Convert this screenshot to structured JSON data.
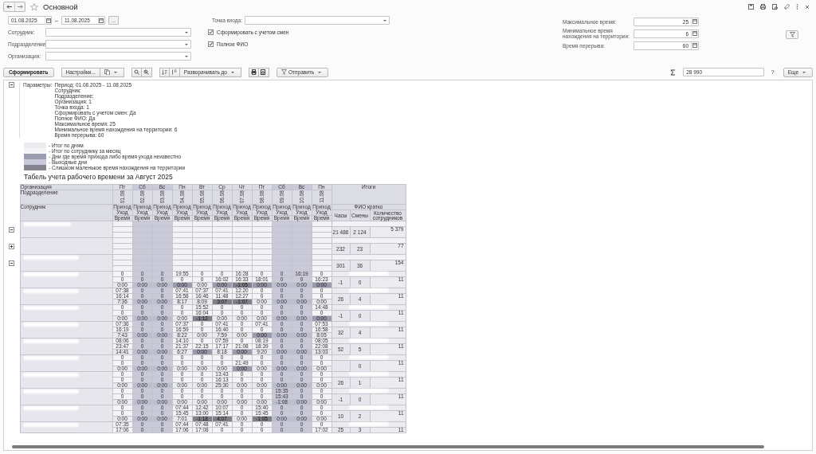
{
  "window": {
    "title": "Основной"
  },
  "filters": {
    "date_from": "01.08.2025",
    "dash": "–",
    "date_to": "11.08.2025",
    "more": "...",
    "fields": [
      {
        "label": "Сотрудник:"
      },
      {
        "label": "Подразделение:"
      },
      {
        "label": "Организация:"
      }
    ],
    "entry_point": {
      "label": "Точка входа:"
    },
    "checkboxes": [
      {
        "label": "Сформировать с учетом смен",
        "checked": true
      },
      {
        "label": "Полное ФИО",
        "checked": true
      }
    ],
    "numbers": [
      {
        "label": "Максимальное время:",
        "value": "25"
      },
      {
        "label": "Минимальное время нахождения на территории:",
        "value": "6"
      },
      {
        "label": "Время перерыва:",
        "value": "60"
      }
    ]
  },
  "toolbar": {
    "generate": "Сформировать",
    "settings": "Настройки...",
    "expand": "Разворачивать до",
    "send": "Отправить",
    "sum": "28 990",
    "help": "?",
    "more": "Еще"
  },
  "report": {
    "parameters": {
      "expanded": true,
      "label": "Параметры:",
      "lines": [
        "Период: 01.08.2025 - 11.08.2025",
        "Сотрудник:",
        "Подразделение:",
        "Организация: 1",
        "Точка входа: 1",
        "Сформировать с учетом смен: Да",
        "Полное ФИО: Да",
        "Максимальное время: 25",
        "Минимальное время нахождения на территории: 6",
        "Время перерыва: 60"
      ]
    },
    "legend": [
      {
        "color": "#ececf0",
        "text": "- Итог по дням"
      },
      {
        "color": "#f4f4f6",
        "text": "- Итог по сотруднику за месяц"
      },
      {
        "color": "#9c9cb0",
        "text": "- Дни где время прихода либо время ухода неизвестно"
      },
      {
        "color": "#c8c8da",
        "text": "- Выходные дни"
      },
      {
        "color": "#85858f",
        "text": "- Слишком маленькое время нахождения на территории"
      }
    ],
    "title": "Табель учета рабочего времени за Август 2025",
    "table": {
      "header": {
        "organization": "Организация",
        "department": "Подразделение",
        "employee": "Сотрудник",
        "totals": "Итоги",
        "short_name": "ФИО кратко",
        "hours": "Часы",
        "shifts": "Смены",
        "count": "Количество сотрудников"
      },
      "days": [
        {
          "dow": "Пт",
          "date": "01.08",
          "weekend": false,
          "arrive": "Приход",
          "leave": "Уход",
          "time": "Время"
        },
        {
          "dow": "Сб",
          "date": "02.08",
          "weekend": true,
          "arrive": "Приход",
          "leave": "Уход",
          "time": "Время"
        },
        {
          "dow": "Вс",
          "date": "03.08",
          "weekend": true,
          "arrive": "Приход",
          "leave": "Уход",
          "time": "Время"
        },
        {
          "dow": "Пн",
          "date": "04.08",
          "weekend": false,
          "arrive": "Приход",
          "leave": "Уход",
          "time": "Время"
        },
        {
          "dow": "Вт",
          "date": "05.08",
          "weekend": false,
          "arrive": "Приход",
          "leave": "Уход",
          "time": "Время"
        },
        {
          "dow": "Ср",
          "date": "06.08",
          "weekend": false,
          "arrive": "Приход",
          "leave": "Уход",
          "time": "Время"
        },
        {
          "dow": "Чт",
          "date": "07.08",
          "weekend": false,
          "arrive": "Приход",
          "leave": "Уход",
          "time": "Время"
        },
        {
          "dow": "Пт",
          "date": "08.08",
          "weekend": false,
          "arrive": "Приход",
          "leave": "Уход",
          "time": "Время"
        },
        {
          "dow": "Сб",
          "date": "09.08",
          "weekend": true,
          "arrive": "Приход",
          "leave": "Уход",
          "time": "Время"
        },
        {
          "dow": "Вс",
          "date": "10.08",
          "weekend": true,
          "arrive": "Приход",
          "leave": "Уход",
          "time": "Время"
        },
        {
          "dow": "Пн",
          "date": "11.08",
          "weekend": false,
          "arrive": "Приход",
          "leave": "Уход",
          "time": "Время"
        }
      ],
      "groups": [
        {
          "expanded": true,
          "hours": "21 486",
          "shifts": "2 124",
          "count": "5 379"
        },
        {
          "expanded": false,
          "hours": "232",
          "shifts": "23",
          "count": "77"
        },
        {
          "expanded": true,
          "hours": "301",
          "shifts": "36",
          "count": "154"
        }
      ],
      "employees": [
        {
          "arrive": [
            "0",
            "0",
            "0",
            "19:55",
            "0",
            "0",
            "16:28",
            "0",
            "0",
            "16:19",
            "0"
          ],
          "leave": [
            "0",
            "0",
            "0",
            "0",
            "0",
            "16:02",
            "16:33",
            "18:01",
            "0",
            "0",
            "16:23"
          ],
          "time": [
            {
              "v": "0:00",
              "unknown": false,
              "short": false
            },
            {
              "v": "0:00",
              "unknown": false,
              "short": false
            },
            {
              "v": "0:00",
              "unknown": false,
              "short": false
            },
            {
              "v": "0:00",
              "unknown": true,
              "short": false
            },
            {
              "v": "0:00",
              "unknown": false,
              "short": false
            },
            {
              "v": "0:00",
              "unknown": true,
              "short": false
            },
            {
              "v": "-1:05",
              "unknown": false,
              "short": true
            },
            {
              "v": "0:00",
              "unknown": true,
              "short": false
            },
            {
              "v": "0:00",
              "unknown": false,
              "short": false
            },
            {
              "v": "0:00",
              "unknown": false,
              "short": false
            },
            {
              "v": "0:00",
              "unknown": true,
              "short": false
            }
          ],
          "hours": "-1",
          "shifts": "0",
          "count": "11"
        },
        {
          "arrive": [
            "07:38",
            "0",
            "0",
            "07:41",
            "07:37",
            "07:41",
            "12:20",
            "0",
            "0",
            "0",
            "0"
          ],
          "leave": [
            "16:14",
            "0",
            "0",
            "16:58",
            "16:46",
            "11:48",
            "12:27",
            "0",
            "0",
            "0",
            "0"
          ],
          "time": [
            {
              "v": "7:36",
              "unknown": false,
              "short": false
            },
            {
              "v": "0:00",
              "unknown": false,
              "short": false
            },
            {
              "v": "0:00",
              "unknown": false,
              "short": false
            },
            {
              "v": "8:17",
              "unknown": false,
              "short": false
            },
            {
              "v": "8:09",
              "unknown": false,
              "short": false
            },
            {
              "v": "3:07",
              "unknown": false,
              "short": true
            },
            {
              "v": "-1:07",
              "unknown": false,
              "short": true
            },
            {
              "v": "0:00",
              "unknown": false,
              "short": false
            },
            {
              "v": "0:00",
              "unknown": false,
              "short": false
            },
            {
              "v": "0:00",
              "unknown": false,
              "short": false
            },
            {
              "v": "0:00",
              "unknown": false,
              "short": false
            }
          ],
          "hours": "26",
          "shifts": "4",
          "count": "11"
        },
        {
          "arrive": [
            "0",
            "0",
            "0",
            "0",
            "15:52",
            "0",
            "0",
            "0",
            "0",
            "0",
            "14:48"
          ],
          "leave": [
            "0",
            "0",
            "0",
            "0",
            "16:04",
            "0",
            "0",
            "0",
            "0",
            "0",
            "0"
          ],
          "time": [
            {
              "v": "0:00",
              "unknown": false,
              "short": false
            },
            {
              "v": "0:00",
              "unknown": false,
              "short": false
            },
            {
              "v": "0:00",
              "unknown": false,
              "short": false
            },
            {
              "v": "0:00",
              "unknown": false,
              "short": false
            },
            {
              "v": "-1:12",
              "unknown": false,
              "short": true
            },
            {
              "v": "0:00",
              "unknown": false,
              "short": false
            },
            {
              "v": "0:00",
              "unknown": false,
              "short": false
            },
            {
              "v": "0:00",
              "unknown": false,
              "short": false
            },
            {
              "v": "0:00",
              "unknown": false,
              "short": false
            },
            {
              "v": "0:00",
              "unknown": false,
              "short": false
            },
            {
              "v": "0:00",
              "unknown": true,
              "short": false
            }
          ],
          "hours": "-1",
          "shifts": "0",
          "count": "11"
        },
        {
          "arrive": [
            "07:36",
            "0",
            "0",
            "07:37",
            "0",
            "07:41",
            "0",
            "07:41",
            "0",
            "0",
            "07:53"
          ],
          "leave": [
            "16:19",
            "0",
            "0",
            "16:59",
            "0",
            "16:40",
            "0",
            "0",
            "0",
            "0",
            "16:58"
          ],
          "time": [
            {
              "v": "7:43",
              "unknown": false,
              "short": false
            },
            {
              "v": "0:00",
              "unknown": false,
              "short": false
            },
            {
              "v": "0:00",
              "unknown": false,
              "short": false
            },
            {
              "v": "8:22",
              "unknown": false,
              "short": false
            },
            {
              "v": "0:00",
              "unknown": false,
              "short": false
            },
            {
              "v": "7:59",
              "unknown": false,
              "short": false
            },
            {
              "v": "0:00",
              "unknown": false,
              "short": false
            },
            {
              "v": "0:00",
              "unknown": true,
              "short": false
            },
            {
              "v": "0:00",
              "unknown": false,
              "short": false
            },
            {
              "v": "0:00",
              "unknown": false,
              "short": false
            },
            {
              "v": "8:05",
              "unknown": false,
              "short": false
            }
          ],
          "hours": "32",
          "shifts": "4",
          "count": "11"
        },
        {
          "arrive": [
            "08:06",
            "0",
            "0",
            "14:10",
            "0",
            "07:59",
            "0",
            "08:19",
            "0",
            "0",
            "08:05"
          ],
          "leave": [
            "23:47",
            "0",
            "0",
            "21:37",
            "22:15",
            "17:17",
            "21:08",
            "18:39",
            "0",
            "0",
            "22:08"
          ],
          "time": [
            {
              "v": "14:41",
              "unknown": false,
              "short": false
            },
            {
              "v": "0:00",
              "unknown": false,
              "short": false
            },
            {
              "v": "0:00",
              "unknown": false,
              "short": false
            },
            {
              "v": "6:27",
              "unknown": false,
              "short": false
            },
            {
              "v": "0:00",
              "unknown": true,
              "short": false
            },
            {
              "v": "8:18",
              "unknown": false,
              "short": false
            },
            {
              "v": "0:00",
              "unknown": true,
              "short": false
            },
            {
              "v": "9:20",
              "unknown": false,
              "short": false
            },
            {
              "v": "0:00",
              "unknown": false,
              "short": false
            },
            {
              "v": "0:00",
              "unknown": false,
              "short": false
            },
            {
              "v": "13:03",
              "unknown": false,
              "short": false
            }
          ],
          "hours": "52",
          "shifts": "5",
          "count": "11"
        },
        {
          "arrive": [
            "0",
            "0",
            "0",
            "0",
            "0",
            "0",
            "0",
            "0",
            "0",
            "0",
            "0"
          ],
          "leave": [
            "0",
            "0",
            "0",
            "0",
            "0",
            "0",
            "21:49",
            "0",
            "0",
            "0",
            "0"
          ],
          "time": [
            {
              "v": "0:00",
              "unknown": false,
              "short": false
            },
            {
              "v": "0:00",
              "unknown": false,
              "short": false
            },
            {
              "v": "0:00",
              "unknown": false,
              "short": false
            },
            {
              "v": "0:00",
              "unknown": false,
              "short": false
            },
            {
              "v": "0:00",
              "unknown": false,
              "short": false
            },
            {
              "v": "0:00",
              "unknown": false,
              "short": false
            },
            {
              "v": "0:00",
              "unknown": true,
              "short": false
            },
            {
              "v": "0:00",
              "unknown": false,
              "short": false
            },
            {
              "v": "0:00",
              "unknown": false,
              "short": false
            },
            {
              "v": "0:00",
              "unknown": false,
              "short": false
            },
            {
              "v": "0:00",
              "unknown": false,
              "short": false
            }
          ],
          "shifts": "0",
          "count": "11"
        },
        {
          "arrive": [
            "0",
            "0",
            "0",
            "0",
            "0",
            "13:43",
            "0",
            "0",
            "0",
            "0",
            "0"
          ],
          "leave": [
            "0",
            "0",
            "0",
            "0",
            "0",
            "16:13",
            "0",
            "0",
            "0",
            "0",
            "0"
          ],
          "time": [
            {
              "v": "0:00",
              "unknown": false,
              "short": false
            },
            {
              "v": "0:00",
              "unknown": false,
              "short": false
            },
            {
              "v": "0:00",
              "unknown": false,
              "short": false
            },
            {
              "v": "0:00",
              "unknown": false,
              "short": false
            },
            {
              "v": "0:00",
              "unknown": false,
              "short": false
            },
            {
              "v": "25:30",
              "unknown": false,
              "short": false
            },
            {
              "v": "0:00",
              "unknown": false,
              "short": false
            },
            {
              "v": "0:00",
              "unknown": false,
              "short": false
            },
            {
              "v": "0:00",
              "unknown": false,
              "short": false
            },
            {
              "v": "0:00",
              "unknown": false,
              "short": false
            },
            {
              "v": "0:00",
              "unknown": false,
              "short": false
            }
          ],
          "hours": "26",
          "shifts": "1",
          "count": "11"
        },
        {
          "arrive": [
            "0",
            "0",
            "0",
            "0",
            "0",
            "0",
            "0",
            "0",
            "15:35",
            "0",
            "0"
          ],
          "leave": [
            "0",
            "0",
            "0",
            "0",
            "0",
            "0",
            "0",
            "0",
            "15:43",
            "0",
            "0"
          ],
          "time": [
            {
              "v": "0:00",
              "unknown": false,
              "short": false
            },
            {
              "v": "0:00",
              "unknown": false,
              "short": false
            },
            {
              "v": "0:00",
              "unknown": false,
              "short": false
            },
            {
              "v": "0:00",
              "unknown": false,
              "short": false
            },
            {
              "v": "0:00",
              "unknown": false,
              "short": false
            },
            {
              "v": "0:00",
              "unknown": false,
              "short": false
            },
            {
              "v": "0:00",
              "unknown": false,
              "short": false
            },
            {
              "v": "0:00",
              "unknown": false,
              "short": false
            },
            {
              "v": "-1:08",
              "unknown": false,
              "short": false
            },
            {
              "v": "0:00",
              "unknown": false,
              "short": false
            },
            {
              "v": "0:00",
              "unknown": false,
              "short": false
            }
          ],
          "hours": "-1",
          "shifts": "0",
          "count": "11"
        },
        {
          "arrive": [
            "0",
            "0",
            "0",
            "07:44",
            "12:42",
            "10:07",
            "0",
            "15:40",
            "0",
            "0",
            "0"
          ],
          "leave": [
            "0",
            "0",
            "0",
            "15:45",
            "13:00",
            "15:14",
            "0",
            "15:45",
            "0",
            "0",
            "0"
          ],
          "time": [
            {
              "v": "0:00",
              "unknown": false,
              "short": false
            },
            {
              "v": "0:00",
              "unknown": false,
              "short": false
            },
            {
              "v": "0:00",
              "unknown": false,
              "short": false
            },
            {
              "v": "7:01",
              "unknown": false,
              "short": false
            },
            {
              "v": "-1:18",
              "unknown": false,
              "short": true
            },
            {
              "v": "4:07",
              "unknown": false,
              "short": true
            },
            {
              "v": "0:00",
              "unknown": false,
              "short": false
            },
            {
              "v": "-1:05",
              "unknown": false,
              "short": true
            },
            {
              "v": "0:00",
              "unknown": false,
              "short": false
            },
            {
              "v": "0:00",
              "unknown": false,
              "short": false
            },
            {
              "v": "0:00",
              "unknown": false,
              "short": false
            }
          ],
          "hours": "10",
          "shifts": "2",
          "count": "11"
        },
        {
          "arrive": [
            "07:35",
            "0",
            "0",
            "07:44",
            "07:48",
            "07:41",
            "0",
            "0",
            "0",
            "0",
            "0"
          ],
          "leave": [
            "17:06",
            "0",
            "0",
            "17:06",
            "17:08",
            "0",
            "0",
            "0",
            "0",
            "0",
            "17:02"
          ],
          "hours": "25",
          "shifts": "3",
          "count": "11"
        }
      ]
    }
  }
}
